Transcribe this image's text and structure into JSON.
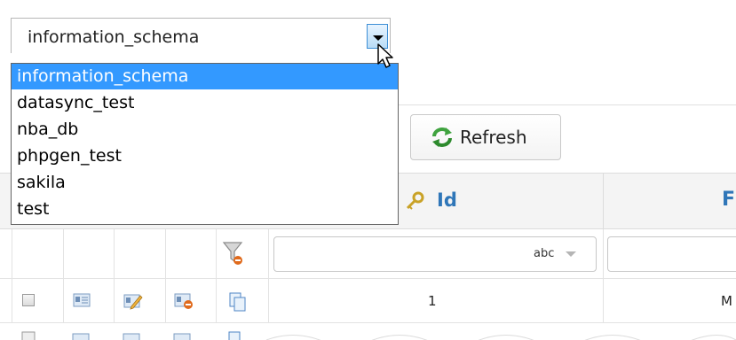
{
  "db_select": {
    "value": "information_schema",
    "options": [
      "information_schema",
      "datasync_test",
      "nba_db",
      "phpgen_test",
      "sakila",
      "test"
    ],
    "selected_index": 0
  },
  "toolbar": {
    "refresh_label": "Refresh"
  },
  "grid": {
    "columns": [
      "Id",
      "F"
    ],
    "filter": {
      "type_label": "abc"
    },
    "rows": [
      {
        "id": "1",
        "f": "M"
      }
    ]
  },
  "colors": {
    "accent": "#2f76b8",
    "selection": "#3399ff"
  }
}
